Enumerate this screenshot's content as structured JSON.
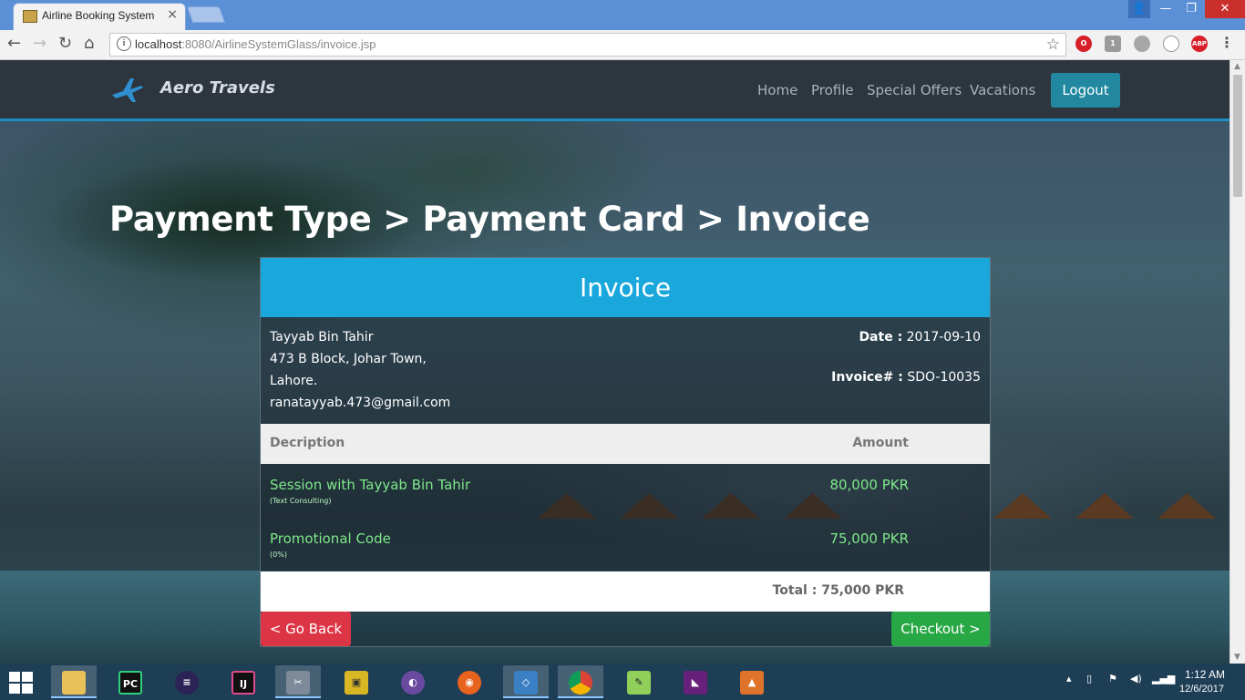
{
  "browser": {
    "tab_title": "Airline Booking System",
    "tab_close": "×",
    "url_host": "localhost",
    "url_rest": ":8080/AirlineSystemGlass/invoice.jsp",
    "bookmark_star": "☆",
    "extensions": [
      "opera-icon",
      "shield-icon",
      "cloud-icon",
      "circle-icon",
      "abp-icon"
    ],
    "abp_label": "ABP",
    "shield_badge": "1",
    "window_controls": {
      "minimize": "—",
      "maximize": "❐",
      "close": "✕",
      "user": "👤"
    }
  },
  "site": {
    "brand": "Aero Travels",
    "nav": {
      "home": "Home",
      "profile": "Profile",
      "special_offers": "Special Offers",
      "vacations": "Vacations"
    },
    "logout": "Logout"
  },
  "page": {
    "title": "Payment Type > Payment Card > Invoice"
  },
  "invoice": {
    "header": "Invoice",
    "billing": {
      "name": "Tayyab Bin Tahir",
      "address_line1": "473 B Block, Johar Town,",
      "address_line2": "Lahore.",
      "email": "ranatayyab.473@gmail.com"
    },
    "meta": {
      "date_label": "Date :",
      "date_value": "2017-09-10",
      "invoice_label": "Invoice# :",
      "invoice_value": "SDO-10035"
    },
    "columns": {
      "description": "Decription",
      "amount": "Amount"
    },
    "items": [
      {
        "name": "Session with Tayyab Bin Tahir",
        "sub": "(Text Consulting)",
        "amount": "80,000 PKR"
      },
      {
        "name": "Promotional Code",
        "sub": "(0%)",
        "amount": "75,000 PKR"
      }
    ],
    "total": "Total : 75,000 PKR",
    "go_back": "< Go Back",
    "checkout": "Checkout >"
  },
  "taskbar": {
    "apps": [
      "file-explorer-icon",
      "pycharm-icon",
      "eclipse-icon",
      "intellij-icon",
      "tools-icon",
      "vmware-icon",
      "tor-icon",
      "firefox-icon",
      "virtualbox-icon",
      "chrome-icon",
      "notepadpp-icon",
      "visual-studio-icon",
      "matlab-icon"
    ],
    "time": "1:12 AM",
    "date": "12/6/2017"
  },
  "colors": {
    "accent": "#1aa7dc",
    "logout": "#21889f",
    "go_back": "#dc3545",
    "checkout": "#28a745",
    "item_text": "#7ee88a"
  }
}
